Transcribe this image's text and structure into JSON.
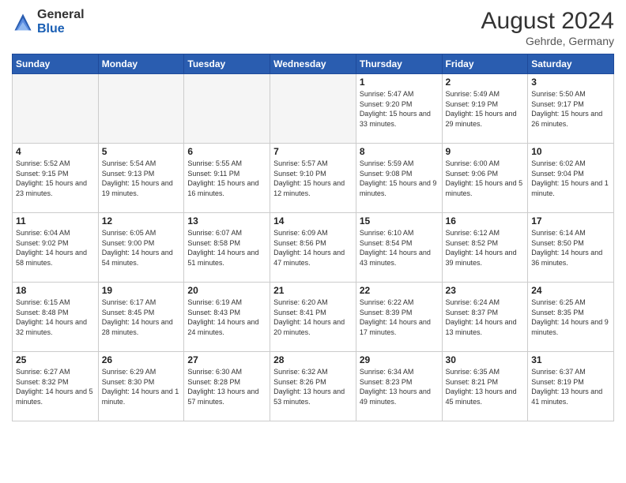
{
  "header": {
    "logo_general": "General",
    "logo_blue": "Blue",
    "month_year": "August 2024",
    "location": "Gehrde, Germany"
  },
  "weekdays": [
    "Sunday",
    "Monday",
    "Tuesday",
    "Wednesday",
    "Thursday",
    "Friday",
    "Saturday"
  ],
  "weeks": [
    [
      {
        "day": "",
        "empty": true
      },
      {
        "day": "",
        "empty": true
      },
      {
        "day": "",
        "empty": true
      },
      {
        "day": "",
        "empty": true
      },
      {
        "day": "1",
        "sunrise": "5:47 AM",
        "sunset": "9:20 PM",
        "daylight": "15 hours and 33 minutes."
      },
      {
        "day": "2",
        "sunrise": "5:49 AM",
        "sunset": "9:19 PM",
        "daylight": "15 hours and 29 minutes."
      },
      {
        "day": "3",
        "sunrise": "5:50 AM",
        "sunset": "9:17 PM",
        "daylight": "15 hours and 26 minutes."
      }
    ],
    [
      {
        "day": "4",
        "sunrise": "5:52 AM",
        "sunset": "9:15 PM",
        "daylight": "15 hours and 23 minutes."
      },
      {
        "day": "5",
        "sunrise": "5:54 AM",
        "sunset": "9:13 PM",
        "daylight": "15 hours and 19 minutes."
      },
      {
        "day": "6",
        "sunrise": "5:55 AM",
        "sunset": "9:11 PM",
        "daylight": "15 hours and 16 minutes."
      },
      {
        "day": "7",
        "sunrise": "5:57 AM",
        "sunset": "9:10 PM",
        "daylight": "15 hours and 12 minutes."
      },
      {
        "day": "8",
        "sunrise": "5:59 AM",
        "sunset": "9:08 PM",
        "daylight": "15 hours and 9 minutes."
      },
      {
        "day": "9",
        "sunrise": "6:00 AM",
        "sunset": "9:06 PM",
        "daylight": "15 hours and 5 minutes."
      },
      {
        "day": "10",
        "sunrise": "6:02 AM",
        "sunset": "9:04 PM",
        "daylight": "15 hours and 1 minute."
      }
    ],
    [
      {
        "day": "11",
        "sunrise": "6:04 AM",
        "sunset": "9:02 PM",
        "daylight": "14 hours and 58 minutes."
      },
      {
        "day": "12",
        "sunrise": "6:05 AM",
        "sunset": "9:00 PM",
        "daylight": "14 hours and 54 minutes."
      },
      {
        "day": "13",
        "sunrise": "6:07 AM",
        "sunset": "8:58 PM",
        "daylight": "14 hours and 51 minutes."
      },
      {
        "day": "14",
        "sunrise": "6:09 AM",
        "sunset": "8:56 PM",
        "daylight": "14 hours and 47 minutes."
      },
      {
        "day": "15",
        "sunrise": "6:10 AM",
        "sunset": "8:54 PM",
        "daylight": "14 hours and 43 minutes."
      },
      {
        "day": "16",
        "sunrise": "6:12 AM",
        "sunset": "8:52 PM",
        "daylight": "14 hours and 39 minutes."
      },
      {
        "day": "17",
        "sunrise": "6:14 AM",
        "sunset": "8:50 PM",
        "daylight": "14 hours and 36 minutes."
      }
    ],
    [
      {
        "day": "18",
        "sunrise": "6:15 AM",
        "sunset": "8:48 PM",
        "daylight": "14 hours and 32 minutes."
      },
      {
        "day": "19",
        "sunrise": "6:17 AM",
        "sunset": "8:45 PM",
        "daylight": "14 hours and 28 minutes."
      },
      {
        "day": "20",
        "sunrise": "6:19 AM",
        "sunset": "8:43 PM",
        "daylight": "14 hours and 24 minutes."
      },
      {
        "day": "21",
        "sunrise": "6:20 AM",
        "sunset": "8:41 PM",
        "daylight": "14 hours and 20 minutes."
      },
      {
        "day": "22",
        "sunrise": "6:22 AM",
        "sunset": "8:39 PM",
        "daylight": "14 hours and 17 minutes."
      },
      {
        "day": "23",
        "sunrise": "6:24 AM",
        "sunset": "8:37 PM",
        "daylight": "14 hours and 13 minutes."
      },
      {
        "day": "24",
        "sunrise": "6:25 AM",
        "sunset": "8:35 PM",
        "daylight": "14 hours and 9 minutes."
      }
    ],
    [
      {
        "day": "25",
        "sunrise": "6:27 AM",
        "sunset": "8:32 PM",
        "daylight": "14 hours and 5 minutes."
      },
      {
        "day": "26",
        "sunrise": "6:29 AM",
        "sunset": "8:30 PM",
        "daylight": "14 hours and 1 minute."
      },
      {
        "day": "27",
        "sunrise": "6:30 AM",
        "sunset": "8:28 PM",
        "daylight": "13 hours and 57 minutes."
      },
      {
        "day": "28",
        "sunrise": "6:32 AM",
        "sunset": "8:26 PM",
        "daylight": "13 hours and 53 minutes."
      },
      {
        "day": "29",
        "sunrise": "6:34 AM",
        "sunset": "8:23 PM",
        "daylight": "13 hours and 49 minutes."
      },
      {
        "day": "30",
        "sunrise": "6:35 AM",
        "sunset": "8:21 PM",
        "daylight": "13 hours and 45 minutes."
      },
      {
        "day": "31",
        "sunrise": "6:37 AM",
        "sunset": "8:19 PM",
        "daylight": "13 hours and 41 minutes."
      }
    ]
  ]
}
